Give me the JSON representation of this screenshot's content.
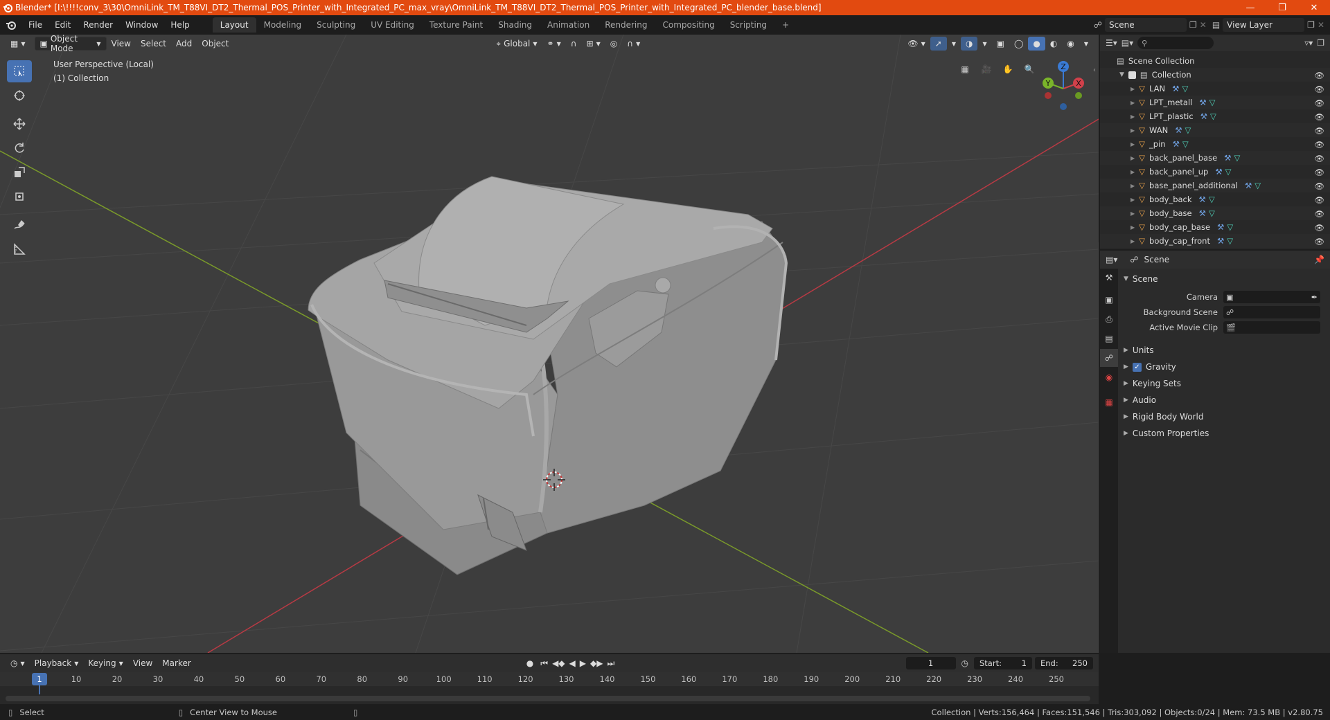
{
  "window": {
    "title": "Blender* [I:\\!!!!conv_3\\30\\OmniLink_TM_T88VI_DT2_Thermal_POS_Printer_with_Integrated_PC_max_vray\\OmniLink_TM_T88VI_DT2_Thermal_POS_Printer_with_Integrated_PC_blender_base.blend]",
    "controls": [
      "minimize",
      "maximize",
      "close"
    ]
  },
  "menubar": {
    "menus": [
      "File",
      "Edit",
      "Render",
      "Window",
      "Help"
    ],
    "workspaces": [
      "Layout",
      "Modeling",
      "Sculpting",
      "UV Editing",
      "Texture Paint",
      "Shading",
      "Animation",
      "Rendering",
      "Compositing",
      "Scripting"
    ],
    "active_workspace": "Layout",
    "add_tab_symbol": "+",
    "scene": "Scene",
    "view_layer": "View Layer"
  },
  "viewport": {
    "mode": "Object Mode",
    "menus": [
      "View",
      "Select",
      "Add",
      "Object"
    ],
    "transform_orientation": "Global",
    "overlay_line1": "User Perspective (Local)",
    "overlay_line2": "(1) Collection",
    "gizmo_axes": {
      "x": "X",
      "y": "Y",
      "z": "Z"
    },
    "background_color": "#3d3d3d",
    "x_axis_color": "#b83a44",
    "y_axis_color": "#7a9a2a"
  },
  "outliner": {
    "root": "Scene Collection",
    "collection": "Collection",
    "objects": [
      "LAN",
      "LPT_metall",
      "LPT_plastic",
      "WAN",
      "_pin",
      "back_panel_base",
      "back_panel_up",
      "base_panel_additional",
      "body_back",
      "body_base",
      "body_cap_base",
      "body_cap_front"
    ]
  },
  "properties": {
    "header_title": "Scene",
    "panel_title": "Scene",
    "rows": [
      {
        "label": "Camera"
      },
      {
        "label": "Background Scene"
      },
      {
        "label": "Active Movie Clip"
      }
    ],
    "subpanels": [
      "Units",
      "Gravity",
      "Keying Sets",
      "Audio",
      "Rigid Body World",
      "Custom Properties"
    ],
    "gravity_checked": true
  },
  "timeline": {
    "menus": [
      "Playback",
      "Keying",
      "View",
      "Marker"
    ],
    "current_frame": "1",
    "start_label": "Start:",
    "start": "1",
    "end_label": "End:",
    "end": "250",
    "ruler_ticks": [
      "1",
      "10",
      "20",
      "30",
      "40",
      "50",
      "60",
      "70",
      "80",
      "90",
      "100",
      "110",
      "120",
      "130",
      "140",
      "150",
      "160",
      "170",
      "180",
      "190",
      "200",
      "210",
      "220",
      "230",
      "240",
      "250"
    ]
  },
  "statusbar": {
    "left_action": "Select",
    "middle_action": "Center View to Mouse",
    "stats": "Collection | Verts:156,464 | Faces:151,546 | Tris:303,092 | Objects:0/24 | Mem: 73.5 MB | v2.80.75"
  }
}
